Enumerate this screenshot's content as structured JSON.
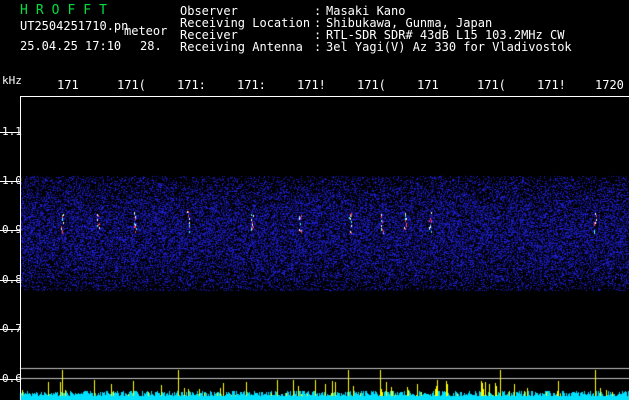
{
  "app": {
    "title": "HROFFT"
  },
  "file": {
    "name": "UT2504251710.pn",
    "suffix": "meteor",
    "datetime": "25.04.25 17:10",
    "extra": "28."
  },
  "info": [
    {
      "label": "Observer",
      "sep": ":",
      "value": "Masaki Kano"
    },
    {
      "label": "Receiving Location",
      "sep": ":",
      "value": "Shibukawa, Gunma, Japan"
    },
    {
      "label": "Receiver",
      "sep": ":",
      "value": "RTL-SDR SDR# 43dB L15 103.2MHz CW"
    },
    {
      "label": "Receiving Antenna",
      "sep": ":",
      "value": "3el Yagi(V) Az 330 for Vladivostok"
    }
  ],
  "axes": {
    "y_unit": "kHz",
    "y_ticks": [
      "1.1",
      "1.0",
      "0.9",
      "0.8",
      "0.7",
      "0.6"
    ],
    "x_ticks": [
      "171",
      "171(",
      "171:",
      "171:",
      "171!",
      "171(",
      "171",
      "171(",
      "171!",
      "1720"
    ]
  },
  "colors": {
    "background": "#000000",
    "title": "#00e040",
    "band": "#1a1aa0",
    "echo": "#ff4060",
    "noise_floor": "#00ffff",
    "spikes": "#ffff00"
  }
}
